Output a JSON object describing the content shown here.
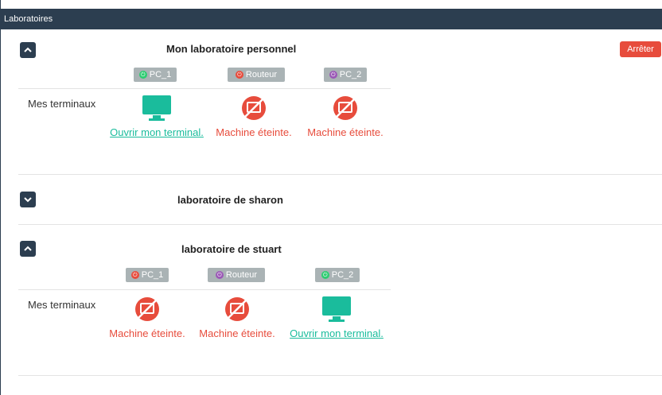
{
  "header": {
    "title": "Laboratoires"
  },
  "labs": [
    {
      "title": "Mon laboratoire personnel",
      "stop_label": "Arrêter",
      "row_label": "Mes terminaux",
      "machines": [
        {
          "name": "PC_1",
          "dot_color": "#2ecc71",
          "status": "Ouvrir mon terminal."
        },
        {
          "name": "Routeur",
          "dot_color": "#e74c3c",
          "status": "Machine éteinte."
        },
        {
          "name": "PC_2",
          "dot_color": "#9b59b6",
          "status": "Machine éteinte."
        }
      ]
    },
    {
      "title": "laboratoire de sharon"
    },
    {
      "title": "laboratoire de stuart",
      "row_label": "Mes terminaux",
      "machines": [
        {
          "name": "PC_1",
          "dot_color": "#e74c3c",
          "status": "Machine éteinte."
        },
        {
          "name": "Routeur",
          "dot_color": "#9b59b6",
          "status": "Machine éteinte."
        },
        {
          "name": "PC_2",
          "dot_color": "#2ecc71",
          "status": "Ouvrir mon terminal."
        }
      ]
    }
  ],
  "colors": {
    "header": "#2c3e50",
    "stop": "#e74c3c",
    "link": "#1abc9c",
    "off": "#e74c3c",
    "badge": "#aab3b5"
  }
}
